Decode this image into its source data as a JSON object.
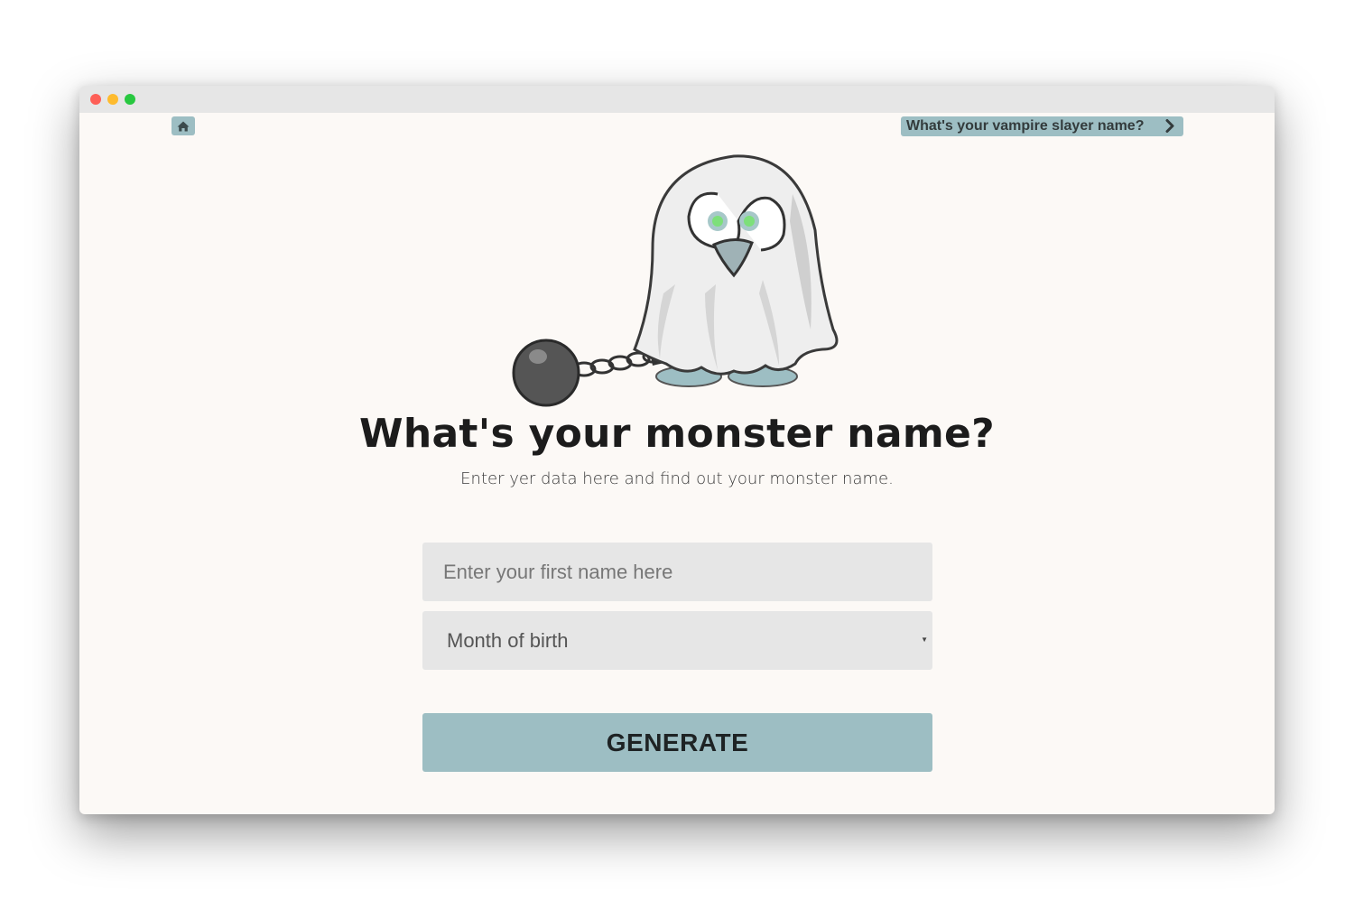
{
  "window": {
    "controls": [
      "close",
      "minimize",
      "zoom"
    ]
  },
  "nav": {
    "home_icon": "home-icon",
    "next_link_label": "What's your vampire slayer name?",
    "next_icon": "chevron-right-icon"
  },
  "hero": {
    "illustration": "ghost-with-ball-and-chain"
  },
  "main": {
    "title": "What's your monster name?",
    "subtitle": "Enter yer data here and find out your monster name."
  },
  "form": {
    "name_placeholder": "Enter your first name here",
    "name_value": "",
    "month_selected": "Month of birth",
    "generate_label": "GENERATE"
  },
  "colors": {
    "accent": "#9dbec3",
    "page_bg": "#fcf9f6",
    "field_bg": "#e6e6e6",
    "text_dark": "#1c1c1c"
  }
}
